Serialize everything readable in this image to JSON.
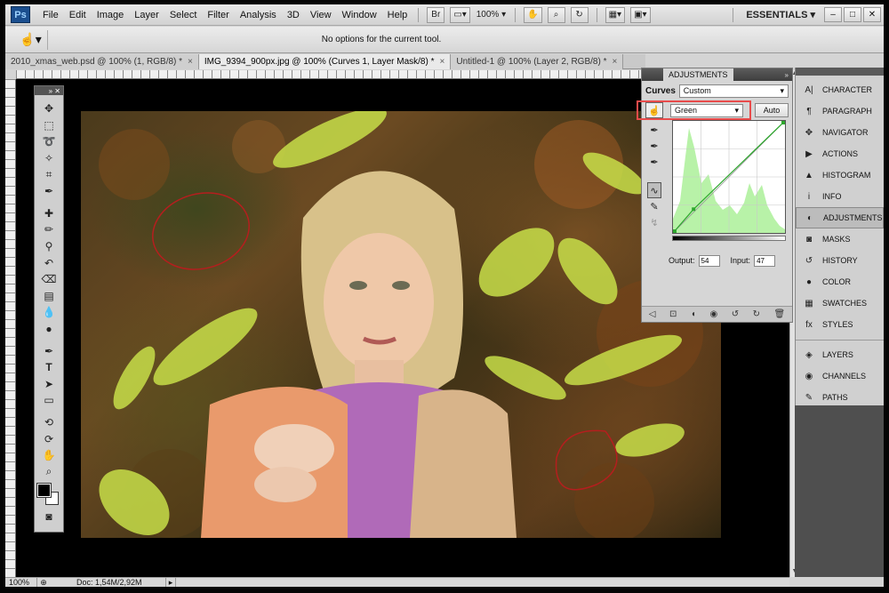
{
  "menubar": {
    "logo": "Ps",
    "items": [
      "File",
      "Edit",
      "Image",
      "Layer",
      "Select",
      "Filter",
      "Analysis",
      "3D",
      "View",
      "Window",
      "Help"
    ],
    "bridge_label": "Br",
    "zoom": "100%",
    "workspace": "ESSENTIALS ▾"
  },
  "options": {
    "message": "No options for the current tool."
  },
  "tabs": [
    {
      "label": "2010_xmas_web.psd @ 100% (1, RGB/8) *",
      "close": "×"
    },
    {
      "label": "IMG_9394_900px.jpg @ 100% (Curves 1, Layer Mask/8) *",
      "close": "×"
    },
    {
      "label": "Untitled-1 @ 100% (Layer 2, RGB/8) *",
      "close": "×"
    }
  ],
  "status": {
    "zoom": "100%",
    "doc": "Doc: 1,54M/2,92M",
    "arrow": "▸"
  },
  "adjustments": {
    "tab_label": "ADJUSTMENTS",
    "collapse": "»",
    "curves_label": "Curves",
    "preset": "Custom",
    "channel": "Green",
    "auto_label": "Auto",
    "output_label": "Output:",
    "output_value": "54",
    "input_label": "Input:",
    "input_value": "47"
  },
  "dock": {
    "top": [
      {
        "label": "CHARACTER",
        "icon": "A|"
      },
      {
        "label": "PARAGRAPH",
        "icon": "¶"
      },
      {
        "label": "NAVIGATOR",
        "icon": "✥"
      },
      {
        "label": "ACTIONS",
        "icon": "▶"
      },
      {
        "label": "HISTOGRAM",
        "icon": "▲"
      },
      {
        "label": "INFO",
        "icon": "i"
      },
      {
        "label": "ADJUSTMENTS",
        "icon": "◐"
      },
      {
        "label": "MASKS",
        "icon": "◙"
      },
      {
        "label": "HISTORY",
        "icon": "↺"
      },
      {
        "label": "COLOR",
        "icon": "●"
      },
      {
        "label": "SWATCHES",
        "icon": "▦"
      },
      {
        "label": "STYLES",
        "icon": "fx"
      }
    ],
    "bottom": [
      {
        "label": "LAYERS",
        "icon": "◈"
      },
      {
        "label": "CHANNELS",
        "icon": "◉"
      },
      {
        "label": "PATHS",
        "icon": "✎"
      }
    ]
  },
  "colors": {
    "highlight_box": "#e84b4b",
    "histogram_fill": "#b8f2a8",
    "curve_line": "#2ea82e"
  },
  "curve": {
    "point": {
      "input": 47,
      "output": 54
    }
  }
}
